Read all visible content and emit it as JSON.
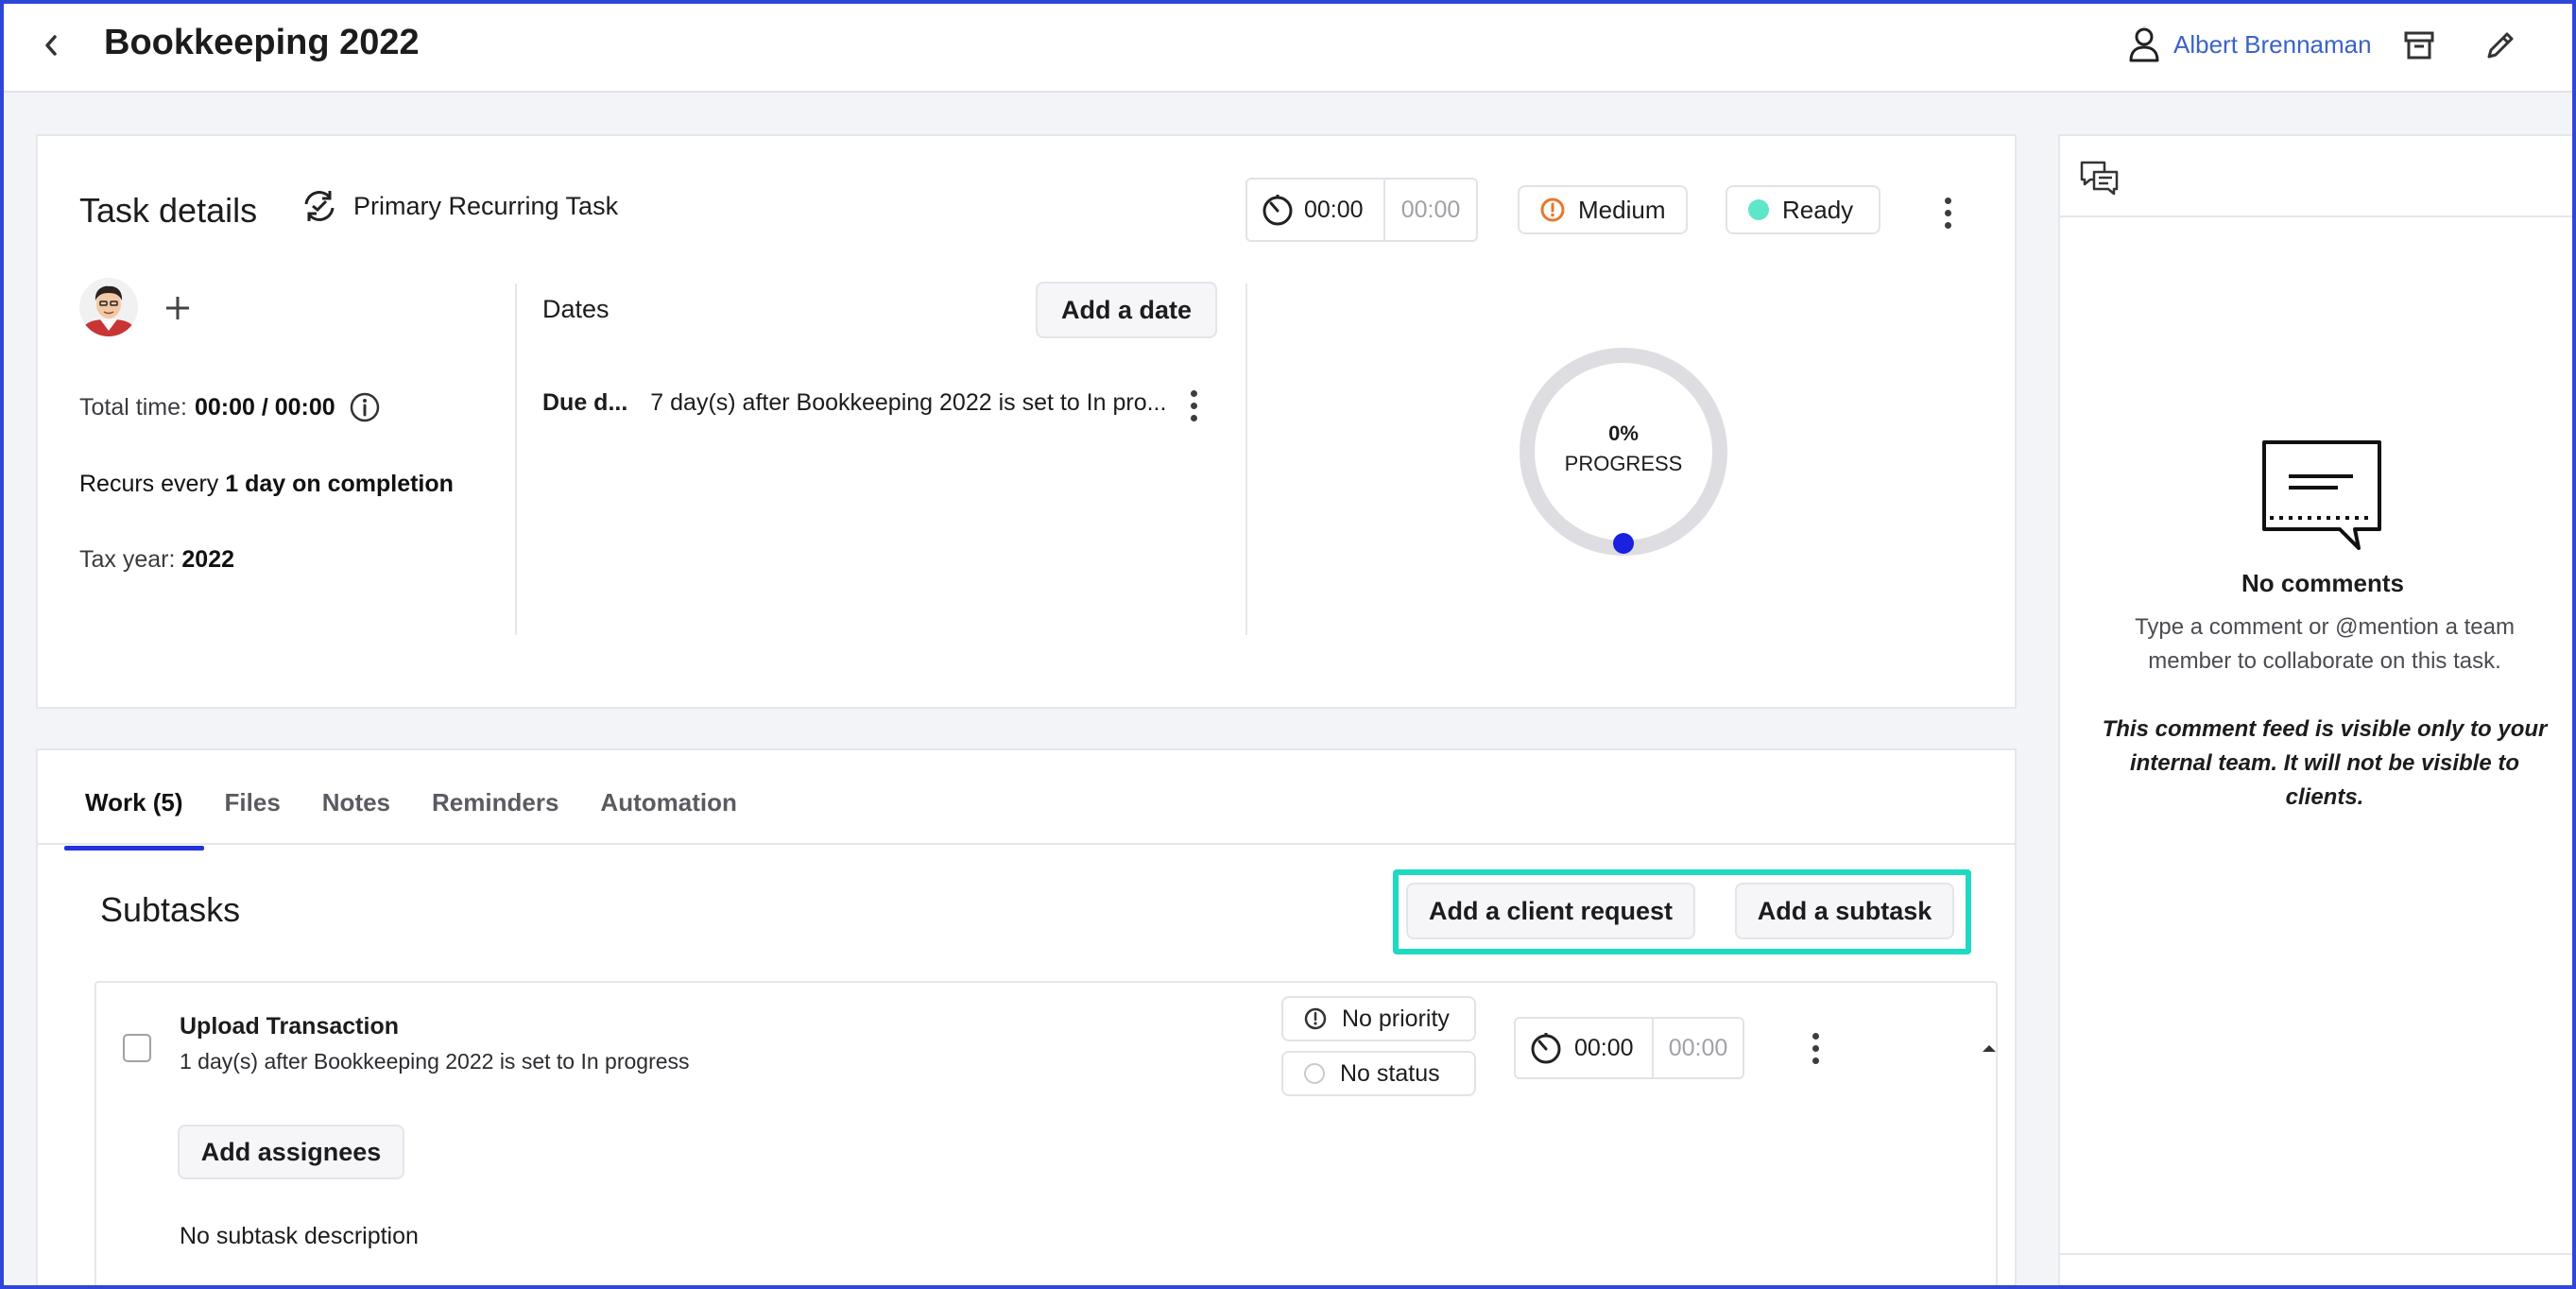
{
  "header": {
    "title": "Bookkeeping 2022",
    "user_name": "Albert Brennaman"
  },
  "task_details": {
    "section_title": "Task details",
    "recurring_label": "Primary Recurring Task",
    "timer_elapsed": "00:00",
    "timer_estimate": "00:00",
    "priority": "Medium",
    "status": "Ready",
    "total_time_label": "Total time:",
    "total_time_value": "00:00 / 00:00",
    "recurs_prefix": "Recurs every",
    "recurs_value": "1 day on completion",
    "tax_year_label": "Tax year:",
    "tax_year_value": "2022",
    "dates_label": "Dates",
    "add_date_label": "Add a date",
    "due_label": "Due d...",
    "due_value": "7 day(s) after Bookkeeping 2022 is set to In pro...",
    "progress_percent": "0%",
    "progress_label": "PROGRESS",
    "progress_value": 0
  },
  "work": {
    "tabs": [
      {
        "label": "Work (5)"
      },
      {
        "label": "Files"
      },
      {
        "label": "Notes"
      },
      {
        "label": "Reminders"
      },
      {
        "label": "Automation"
      }
    ],
    "subtasks_title": "Subtasks",
    "add_client_request_label": "Add a client request",
    "add_subtask_label": "Add a subtask",
    "subtask": {
      "title": "Upload Transaction",
      "subtitle": "1 day(s) after Bookkeeping 2022 is set to In progress",
      "priority": "No priority",
      "status": "No status",
      "timer_elapsed": "00:00",
      "timer_estimate": "00:00",
      "add_assignees_label": "Add assignees",
      "description": "No subtask description"
    }
  },
  "comments": {
    "empty_title": "No comments",
    "hint": "Type a comment or @mention a team member to collaborate on this task.",
    "note": "This comment feed is visible only to your internal team. It will not be visible to clients."
  },
  "colors": {
    "accent": "#2331e0",
    "link": "#3a63c8",
    "highlight": "#1fd9c2",
    "priority_medium": "#e8782a",
    "status_ready": "#5ee6c8",
    "progress_dot": "#1a22e0"
  }
}
